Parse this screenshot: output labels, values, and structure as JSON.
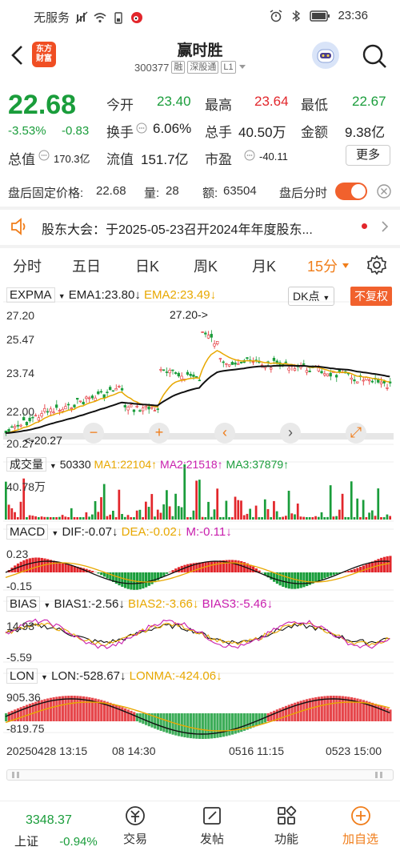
{
  "status_bar": {
    "carrier": "无服务",
    "time": "23:36"
  },
  "header": {
    "logo_line1": "东方",
    "logo_line2": "财富",
    "title": "赢时胜",
    "code": "300377",
    "tags": [
      "融",
      "深股通",
      "L1"
    ]
  },
  "quote": {
    "price": "22.68",
    "change_pct": "-3.53%",
    "change": "-0.83",
    "open_label": "今开",
    "open": "23.40",
    "high_label": "最高",
    "high": "23.64",
    "low_label": "最低",
    "low": "22.67",
    "turnover_label": "换手",
    "turnover": "6.06%",
    "volume_label": "总手",
    "volume": "40.50万",
    "amount_label": "金额",
    "amount": "9.38亿",
    "mktcap_label": "总值",
    "mktcap": "170.3亿",
    "float_label": "流值",
    "float": "151.7亿",
    "pe_label": "市盈",
    "pe": "-40.11",
    "more_label": "更多"
  },
  "after_hours": {
    "price_label": "盘后固定价格:",
    "price": "22.68",
    "qty_label": "量:",
    "qty": "28",
    "amt_label": "额:",
    "amt": "63504",
    "toggle_label": "盘后分时",
    "toggle_on": true
  },
  "notice": {
    "text": "股东大会：于2025-05-23召开2024年年度股东..."
  },
  "tabs": [
    "分时",
    "五日",
    "日K",
    "周K",
    "月K",
    "15分"
  ],
  "active_tab": "15分",
  "chart": {
    "main": {
      "indicator": "EXPMA",
      "ema1": "EMA1:23.80",
      "ema2": "EMA2:23.49",
      "dk_label": "DK点",
      "adj_label": "不复权",
      "y_labels": [
        "27.20",
        "25.47",
        "23.74",
        "22.00",
        "20.27"
      ],
      "max_marker": "27.20->",
      "min_marker": "<-20.27"
    },
    "volume": {
      "name": "成交量",
      "value": "50330",
      "ma1": "MA1:22104",
      "ma2": "MA2:21518",
      "ma3": "MA3:37879",
      "y_label": "40.78万"
    },
    "macd": {
      "name": "MACD",
      "dif": "DIF:-0.07",
      "dea": "DEA:-0.02",
      "m": "M:-0.11",
      "y_top": "0.23",
      "y_bottom": "-0.15"
    },
    "bias": {
      "name": "BIAS",
      "b1": "BIAS1:-2.56",
      "b2": "BIAS2:-3.66",
      "b3": "BIAS3:-5.46",
      "y_top": "14.93",
      "y_bottom": "-5.59"
    },
    "lon": {
      "name": "LON",
      "lon": "LON:-528.67",
      "lonma": "LONMA:-424.06",
      "y_top": "905.36",
      "y_bottom": "-819.75"
    },
    "time_labels": [
      "20250428 13:15",
      "08 14:30",
      "0516 11:15",
      "0523 15:00"
    ],
    "colors": {
      "up": "#e2262b",
      "down": "#1a9d3b",
      "ema2": "#e8a800",
      "pink": "#c91fae"
    }
  },
  "bottom_nav": {
    "index_value": "3348.37",
    "index_name": "上证",
    "index_change": "-0.94%",
    "items": [
      "交易",
      "发帖",
      "功能",
      "加自选"
    ]
  }
}
